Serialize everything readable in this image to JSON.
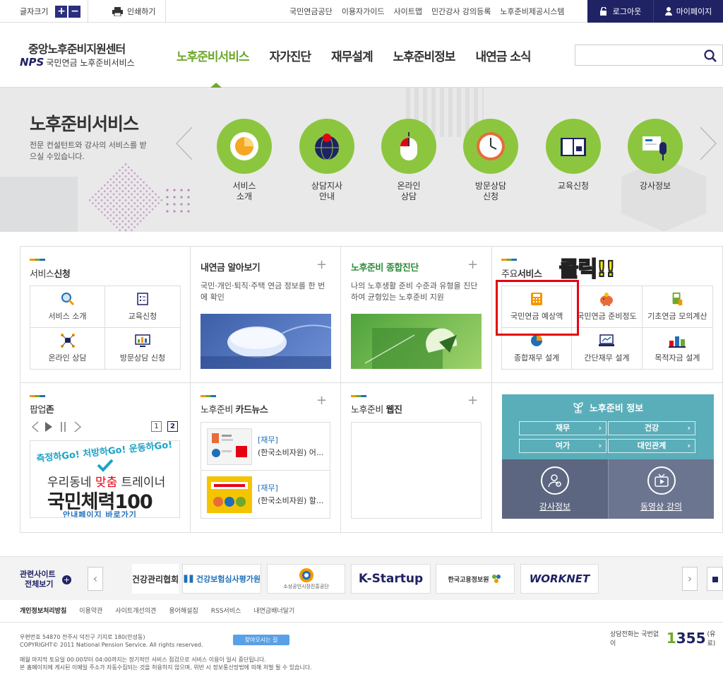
{
  "topbar": {
    "font_size_label": "글자크기",
    "font_plus": "+",
    "font_minus": "−",
    "print_label": "인쇄하기",
    "links": [
      "국민연금공단",
      "이용자가이드",
      "사이트맵",
      "민간강사 강의등록",
      "노후준비제공시스템"
    ],
    "logout_label": "로그아웃",
    "mypage_label": "마이페이지"
  },
  "header": {
    "logo_title": "중앙노후준비지원센터",
    "logo_nps": "NPS",
    "logo_sub": "국민연금 노후준비서비스",
    "nav": [
      "노후준비서비스",
      "자가진단",
      "재무설계",
      "노후준비정보",
      "내연금 소식"
    ],
    "active_nav": "노후준비서비스",
    "search_placeholder": ""
  },
  "hero": {
    "title": "노후준비서비스",
    "desc": "전문 컨설턴트와 강사의 서비스를 받으실 수있습니다.",
    "services": [
      {
        "line1": "서비스",
        "line2": "소개",
        "icon": "pie-chart-icon"
      },
      {
        "line1": "상담지사",
        "line2": "안내",
        "icon": "globe-pin-icon"
      },
      {
        "line1": "온라인",
        "line2": "상담",
        "icon": "mouse-icon"
      },
      {
        "line1": "방문상담",
        "line2": "신청",
        "icon": "clock-icon"
      },
      {
        "line1": "교육신청",
        "line2": "",
        "icon": "book-icon"
      },
      {
        "line1": "강사정보",
        "line2": "",
        "icon": "microphone-icon"
      }
    ]
  },
  "service_apply": {
    "title_prefix": "서비스",
    "title_bold": "신청",
    "items": [
      "서비스 소개",
      "교육신청",
      "온라인 상담",
      "방문상담 신청"
    ]
  },
  "my_pension": {
    "title": "내연금 알아보기",
    "desc": "국민·개인·퇴직·주택 연금 정보를 한 번에 확인"
  },
  "diagnosis": {
    "title": "노후준비 종합진단",
    "desc": "나의 노후생활 준비 수준과 유형을 진단하여 균형있는 노후준비 지원"
  },
  "main_services": {
    "title_prefix": "주요",
    "title_bold": "서비스",
    "items": [
      "국민연금 예상액",
      "국민연금 준비정도",
      "기초연금 모의계산",
      "종합재무 설계",
      "간단재무 설계",
      "목적자금 설계"
    ],
    "annotation": "클릭!!"
  },
  "popup_zone": {
    "title_prefix": "팝업",
    "title_bold": "존",
    "pages": [
      "1",
      "2"
    ],
    "banner_line1": "측정하Go! 처방하Go! 운동하Go!",
    "banner_line2a": "우리동네 ",
    "banner_line2b": "맞춤",
    "banner_line2c": " 트레이너",
    "banner_line3": "국민체력100",
    "banner_line4": "안내페이지 바로가기"
  },
  "card_news": {
    "title_prefix": "노후준비 ",
    "title_bold": "카드뉴스",
    "items": [
      {
        "cat": "[재무]",
        "title": "(한국소비자원) 어..."
      },
      {
        "cat": "[재무]",
        "title": "(한국소비자원) 할..."
      }
    ]
  },
  "webzine": {
    "title_prefix": "노후준비 ",
    "title_bold": "웹진"
  },
  "info": {
    "title": "노후준비 정보",
    "buttons": [
      "재무",
      "건강",
      "여가",
      "대인관계"
    ],
    "instructor": "강사정보",
    "video": "동영상 강의"
  },
  "related": {
    "label_line1": "관련사이트",
    "label_line2": "전체보기",
    "sites": [
      "건강관리협회",
      "건강보험심사평가원",
      "소상공인시장진흥공단",
      "K-Startup",
      "한국고용정보원",
      "WORKNET"
    ]
  },
  "footer": {
    "links": [
      "개인정보처리방침",
      "이용약관",
      "사이트개선의견",
      "용어해설집",
      "RSS서비스",
      "내연금배너달기"
    ],
    "address": "우편번호 54870   전주시 덕진구 기지로 180(만성동)",
    "copyright": "COPYRIGHT© 2011 National Pension Service. All rights reserved.",
    "map_btn": "찾아오시는 길",
    "note1": "매월 마지막 토요일 00:00부터 04:00까지는 정기적인 서비스 점검으로 서비스 이용이 일시 중단됩니다.",
    "note2": "본 홈페이지에 게시된 이메일 주소가 자동수집되는 것을 허용하지 않으며, 위반 시 정보통신망법에 의해 처벌 될 수 있습니다.",
    "call_label": "상담전화는 국번없이",
    "call_number_a": "1",
    "call_number_b": "355",
    "call_suffix": "(유료)"
  },
  "colors": {
    "navy": "#1f2263",
    "green": "#8cc63f",
    "accent_green": "#6fa72c",
    "teal": "#5aaeba",
    "slate": "#5c6680",
    "red": "#e60012",
    "yellow": "#ffe600"
  }
}
